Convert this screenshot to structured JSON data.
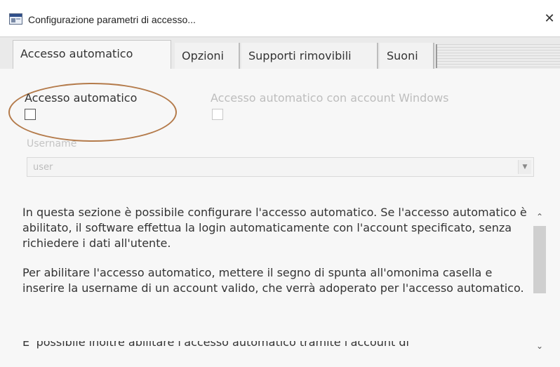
{
  "window": {
    "title": "Configurazione parametri di accesso...",
    "close_glyph": "✕",
    "icon": "app-window-icon"
  },
  "tabs": [
    {
      "label": "Accesso automatico",
      "active": true
    },
    {
      "label": "Opzioni",
      "active": false
    },
    {
      "label": "Supporti rimovibili",
      "active": false
    },
    {
      "label": "Suoni",
      "active": false
    }
  ],
  "auto_login": {
    "label": "Accesso automatico",
    "checked": false
  },
  "windows_login": {
    "label": "Accesso automatico con account Windows",
    "checked": false,
    "enabled": false
  },
  "username": {
    "label": "Username",
    "value": "user",
    "dropdown_icon": "chevron-down-icon"
  },
  "help": {
    "paragraphs": [
      "In questa sezione è possibile configurare l'accesso automatico. Se l'accesso automatico è abilitato, il software effettua la login automaticamente con l'account specificato, senza richiedere i dati all'utente.",
      "Per abilitare l'accesso automatico, mettere il segno di spunta all'omonima casella e inserire la username di un account valido, che verrà adoperato per l'accesso automatico."
    ],
    "cut_line": "E' possibile inoltre abilitare l'accesso automatico tramite l'account di"
  },
  "scrollbar": {
    "up_glyph": "⌃",
    "down_glyph": "⌄"
  },
  "colors": {
    "highlight_ellipse": "#b47b4b",
    "disabled_text": "#bdbdbd"
  }
}
